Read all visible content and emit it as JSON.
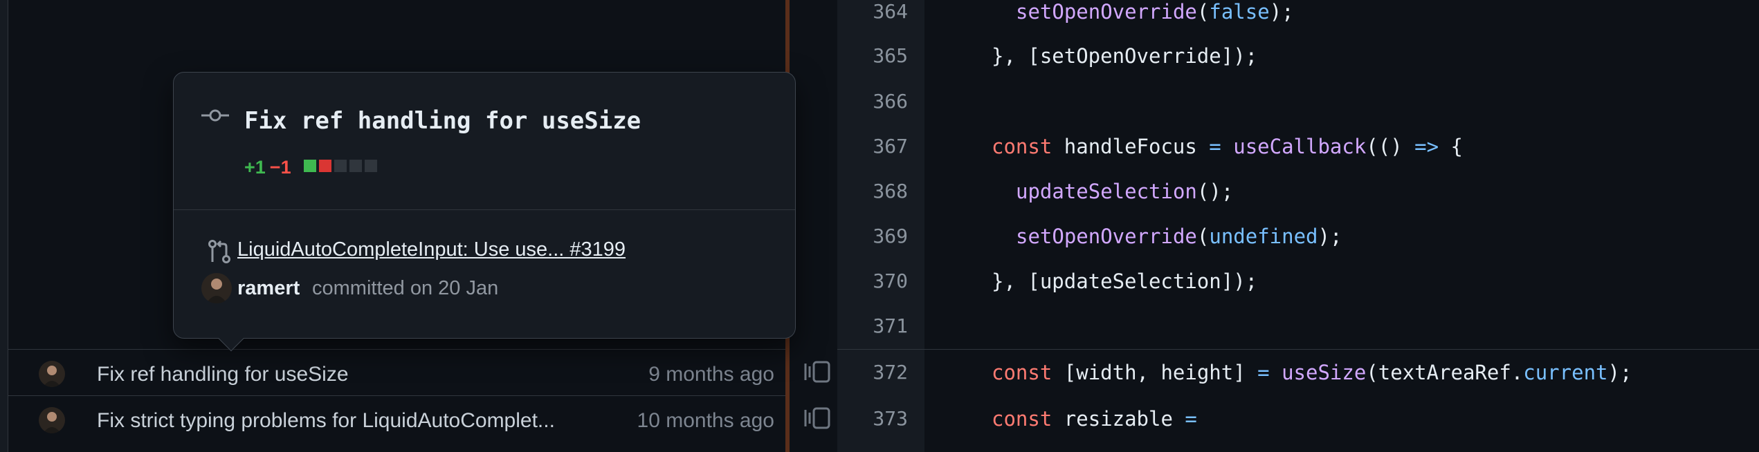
{
  "colors": {
    "background": "#0d1117",
    "gutter": "#161b22",
    "additions": "#3fb950",
    "deletions": "#f85149",
    "keyword": "#ff7b72",
    "function": "#d2a8ff",
    "operator": "#79c0ff"
  },
  "blame": {
    "rows": [
      {
        "message": "Fix ref handling for useSize",
        "age": "9 months ago",
        "avatar_icon": "user-avatar"
      },
      {
        "message": "Fix strict typing problems for LiquidAutoComplet...",
        "age": "10 months ago",
        "avatar_icon": "user-avatar"
      }
    ],
    "reblame_icon": "reblame-icon"
  },
  "hovercard": {
    "commit_icon": "git-commit-icon",
    "title": "Fix ref handling for useSize",
    "additions": "+1",
    "deletions": "−1",
    "diff_blocks": [
      "add",
      "del",
      "neutral",
      "neutral",
      "neutral"
    ],
    "pr_icon": "git-pull-request-icon",
    "pr_link": "LiquidAutoCompleteInput: Use use... #3199",
    "author": "ramert",
    "committed": "committed on 20 Jan"
  },
  "code": {
    "lines": [
      {
        "num": "364"
      },
      {
        "num": "365"
      },
      {
        "num": "366"
      },
      {
        "num": "367"
      },
      {
        "num": "368"
      },
      {
        "num": "369"
      },
      {
        "num": "370"
      },
      {
        "num": "371"
      },
      {
        "num": "372"
      },
      {
        "num": "373"
      }
    ],
    "t364a": "setOpenOverride",
    "t364b": "(",
    "t364c": "false",
    "t364d": ");",
    "t365a": "}, [setOpenOverride]);",
    "t367a": "const",
    "t367b": " handleFocus ",
    "t367c": "=",
    "t367d": " ",
    "t367e": "useCallback",
    "t367f": "(() ",
    "t367g": "=>",
    "t367h": " {",
    "t368a": "updateSelection",
    "t368b": "();",
    "t369a": "setOpenOverride",
    "t369b": "(",
    "t369c": "undefined",
    "t369d": ");",
    "t370a": "}, [updateSelection]);",
    "t372a": "const",
    "t372b": " [width, height] ",
    "t372c": "=",
    "t372d": " ",
    "t372e": "useSize",
    "t372f": "(textAreaRef.",
    "t372g": "current",
    "t372h": ");",
    "t373a": "const",
    "t373b": " resizable ",
    "t373c": "="
  }
}
